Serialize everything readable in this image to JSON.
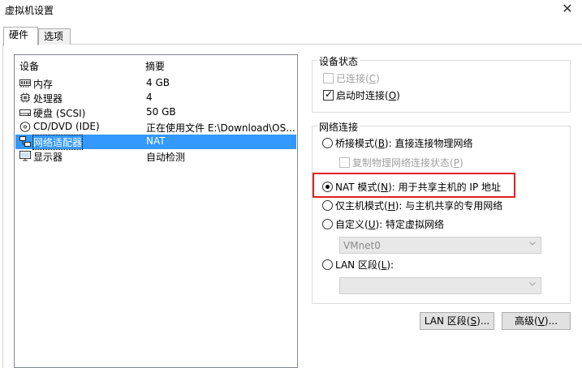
{
  "window": {
    "title": "虚拟机设置"
  },
  "tabs": [
    {
      "label": "硬件"
    },
    {
      "label": "选项"
    }
  ],
  "devices": {
    "header": {
      "device": "设备",
      "summary": "摘要"
    },
    "rows": [
      {
        "name": "内存",
        "summary": "4 GB",
        "icon": "memory-icon"
      },
      {
        "name": "处理器",
        "summary": "4",
        "icon": "cpu-icon"
      },
      {
        "name": "硬盘 (SCSI)",
        "summary": "50 GB",
        "icon": "hard-disk-icon"
      },
      {
        "name": "CD/DVD (IDE)",
        "summary": "正在使用文件 E:\\Download\\OS...",
        "icon": "cd-dvd-icon"
      },
      {
        "name": "网络适配器",
        "summary": "NAT",
        "icon": "network-adapter-icon",
        "selected": true
      },
      {
        "name": "显示器",
        "summary": "自动检测",
        "icon": "monitor-icon"
      }
    ]
  },
  "device_status": {
    "title": "设备状态",
    "connected": {
      "label": "已连接(",
      "key": "C",
      "suffix": ")",
      "checked": false,
      "enabled": false
    },
    "connect_at_power_on": {
      "label": "启动时连接(",
      "key": "O",
      "suffix": ")",
      "checked": true
    }
  },
  "network": {
    "title": "网络连接",
    "bridged": {
      "label": "桥接模式(",
      "key": "B",
      "suffix": "): 直接连接物理网络"
    },
    "replicate": {
      "label": "复制物理网络连接状态(",
      "key": "P",
      "suffix": ")"
    },
    "nat": {
      "label": "NAT 模式(",
      "key": "N",
      "suffix": "): 用于共享主机的 IP 地址",
      "selected": true
    },
    "host_only": {
      "label": "仅主机模式(",
      "key": "H",
      "suffix": "): 与主机共享的专用网络"
    },
    "custom": {
      "label": "自定义(",
      "key": "U",
      "suffix": "): 特定虚拟网络"
    },
    "custom_select": {
      "value": "VMnet0"
    },
    "lan": {
      "label": "LAN 区段(",
      "key": "L",
      "suffix": "):"
    },
    "lan_select": {
      "value": ""
    }
  },
  "buttons": {
    "lan_segments": {
      "label": "LAN 区段(",
      "key": "S",
      "suffix": ")..."
    },
    "advanced": {
      "label": "高级(",
      "key": "V",
      "suffix": ")..."
    }
  },
  "colors": {
    "selection": "#3399ff",
    "highlight": "#e02020"
  }
}
